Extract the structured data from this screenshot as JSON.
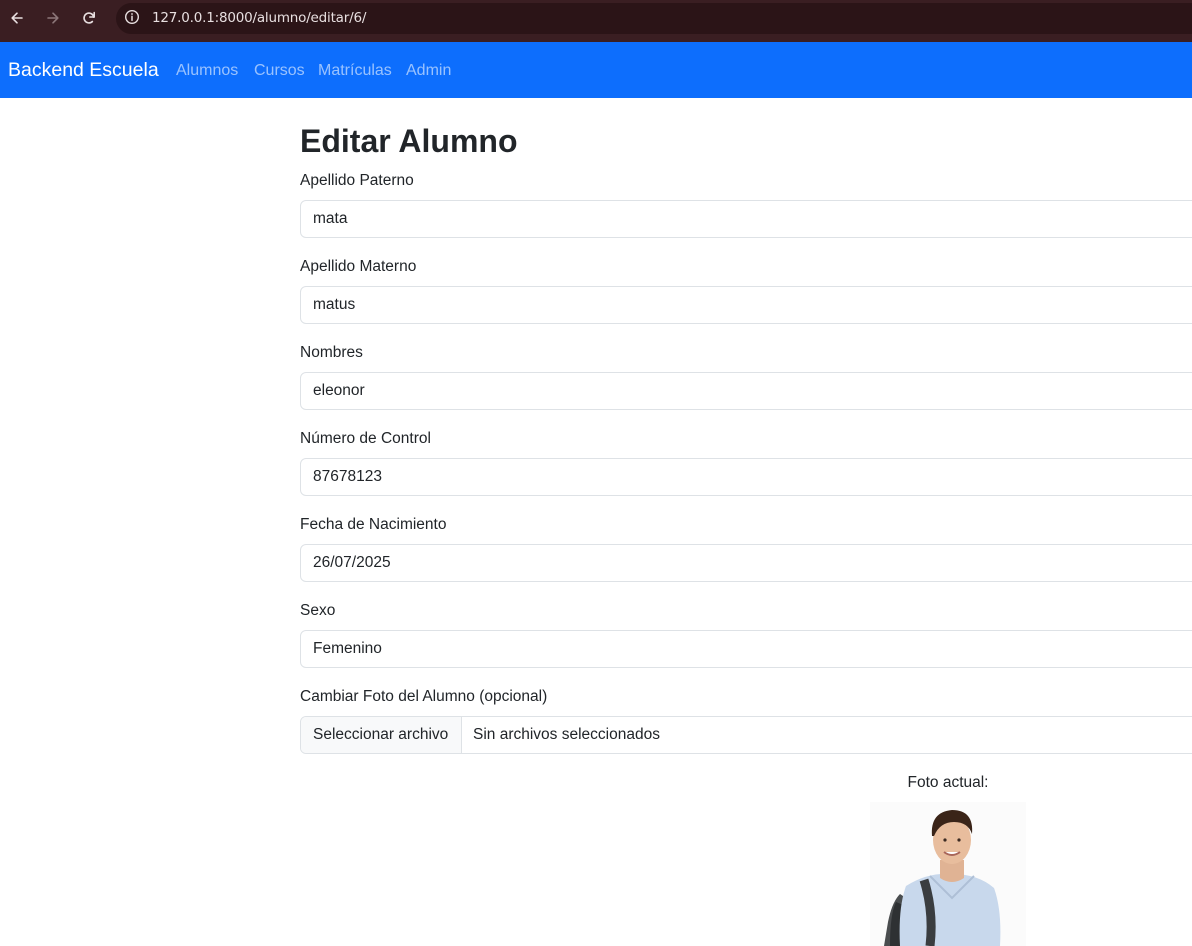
{
  "browser": {
    "url": "127.0.0.1:8000/alumno/editar/6/",
    "icons": [
      "back-icon",
      "forward-icon",
      "reload-icon",
      "info-icon"
    ]
  },
  "navbar": {
    "brand": "Backend Escuela",
    "links": [
      "Alumnos",
      "Cursos",
      "Matrículas",
      "Admin"
    ],
    "color": "#0d6efd"
  },
  "form": {
    "title": "Editar Alumno",
    "fields": [
      {
        "label": "Apellido Paterno",
        "value": "mata"
      },
      {
        "label": "Apellido Materno",
        "value": "matus"
      },
      {
        "label": "Nombres",
        "value": "eleonor"
      },
      {
        "label": "Número de Control",
        "value": "87678123"
      },
      {
        "label": "Fecha de Nacimiento",
        "value": "26/07/2025"
      },
      {
        "label": "Sexo",
        "value": "Femenino"
      }
    ],
    "photo_upload": {
      "label": "Cambiar Foto del Alumno (opcional)",
      "button": "Seleccionar archivo",
      "status": "Sin archivos seleccionados"
    },
    "current_photo": {
      "caption": "Foto actual:"
    }
  }
}
